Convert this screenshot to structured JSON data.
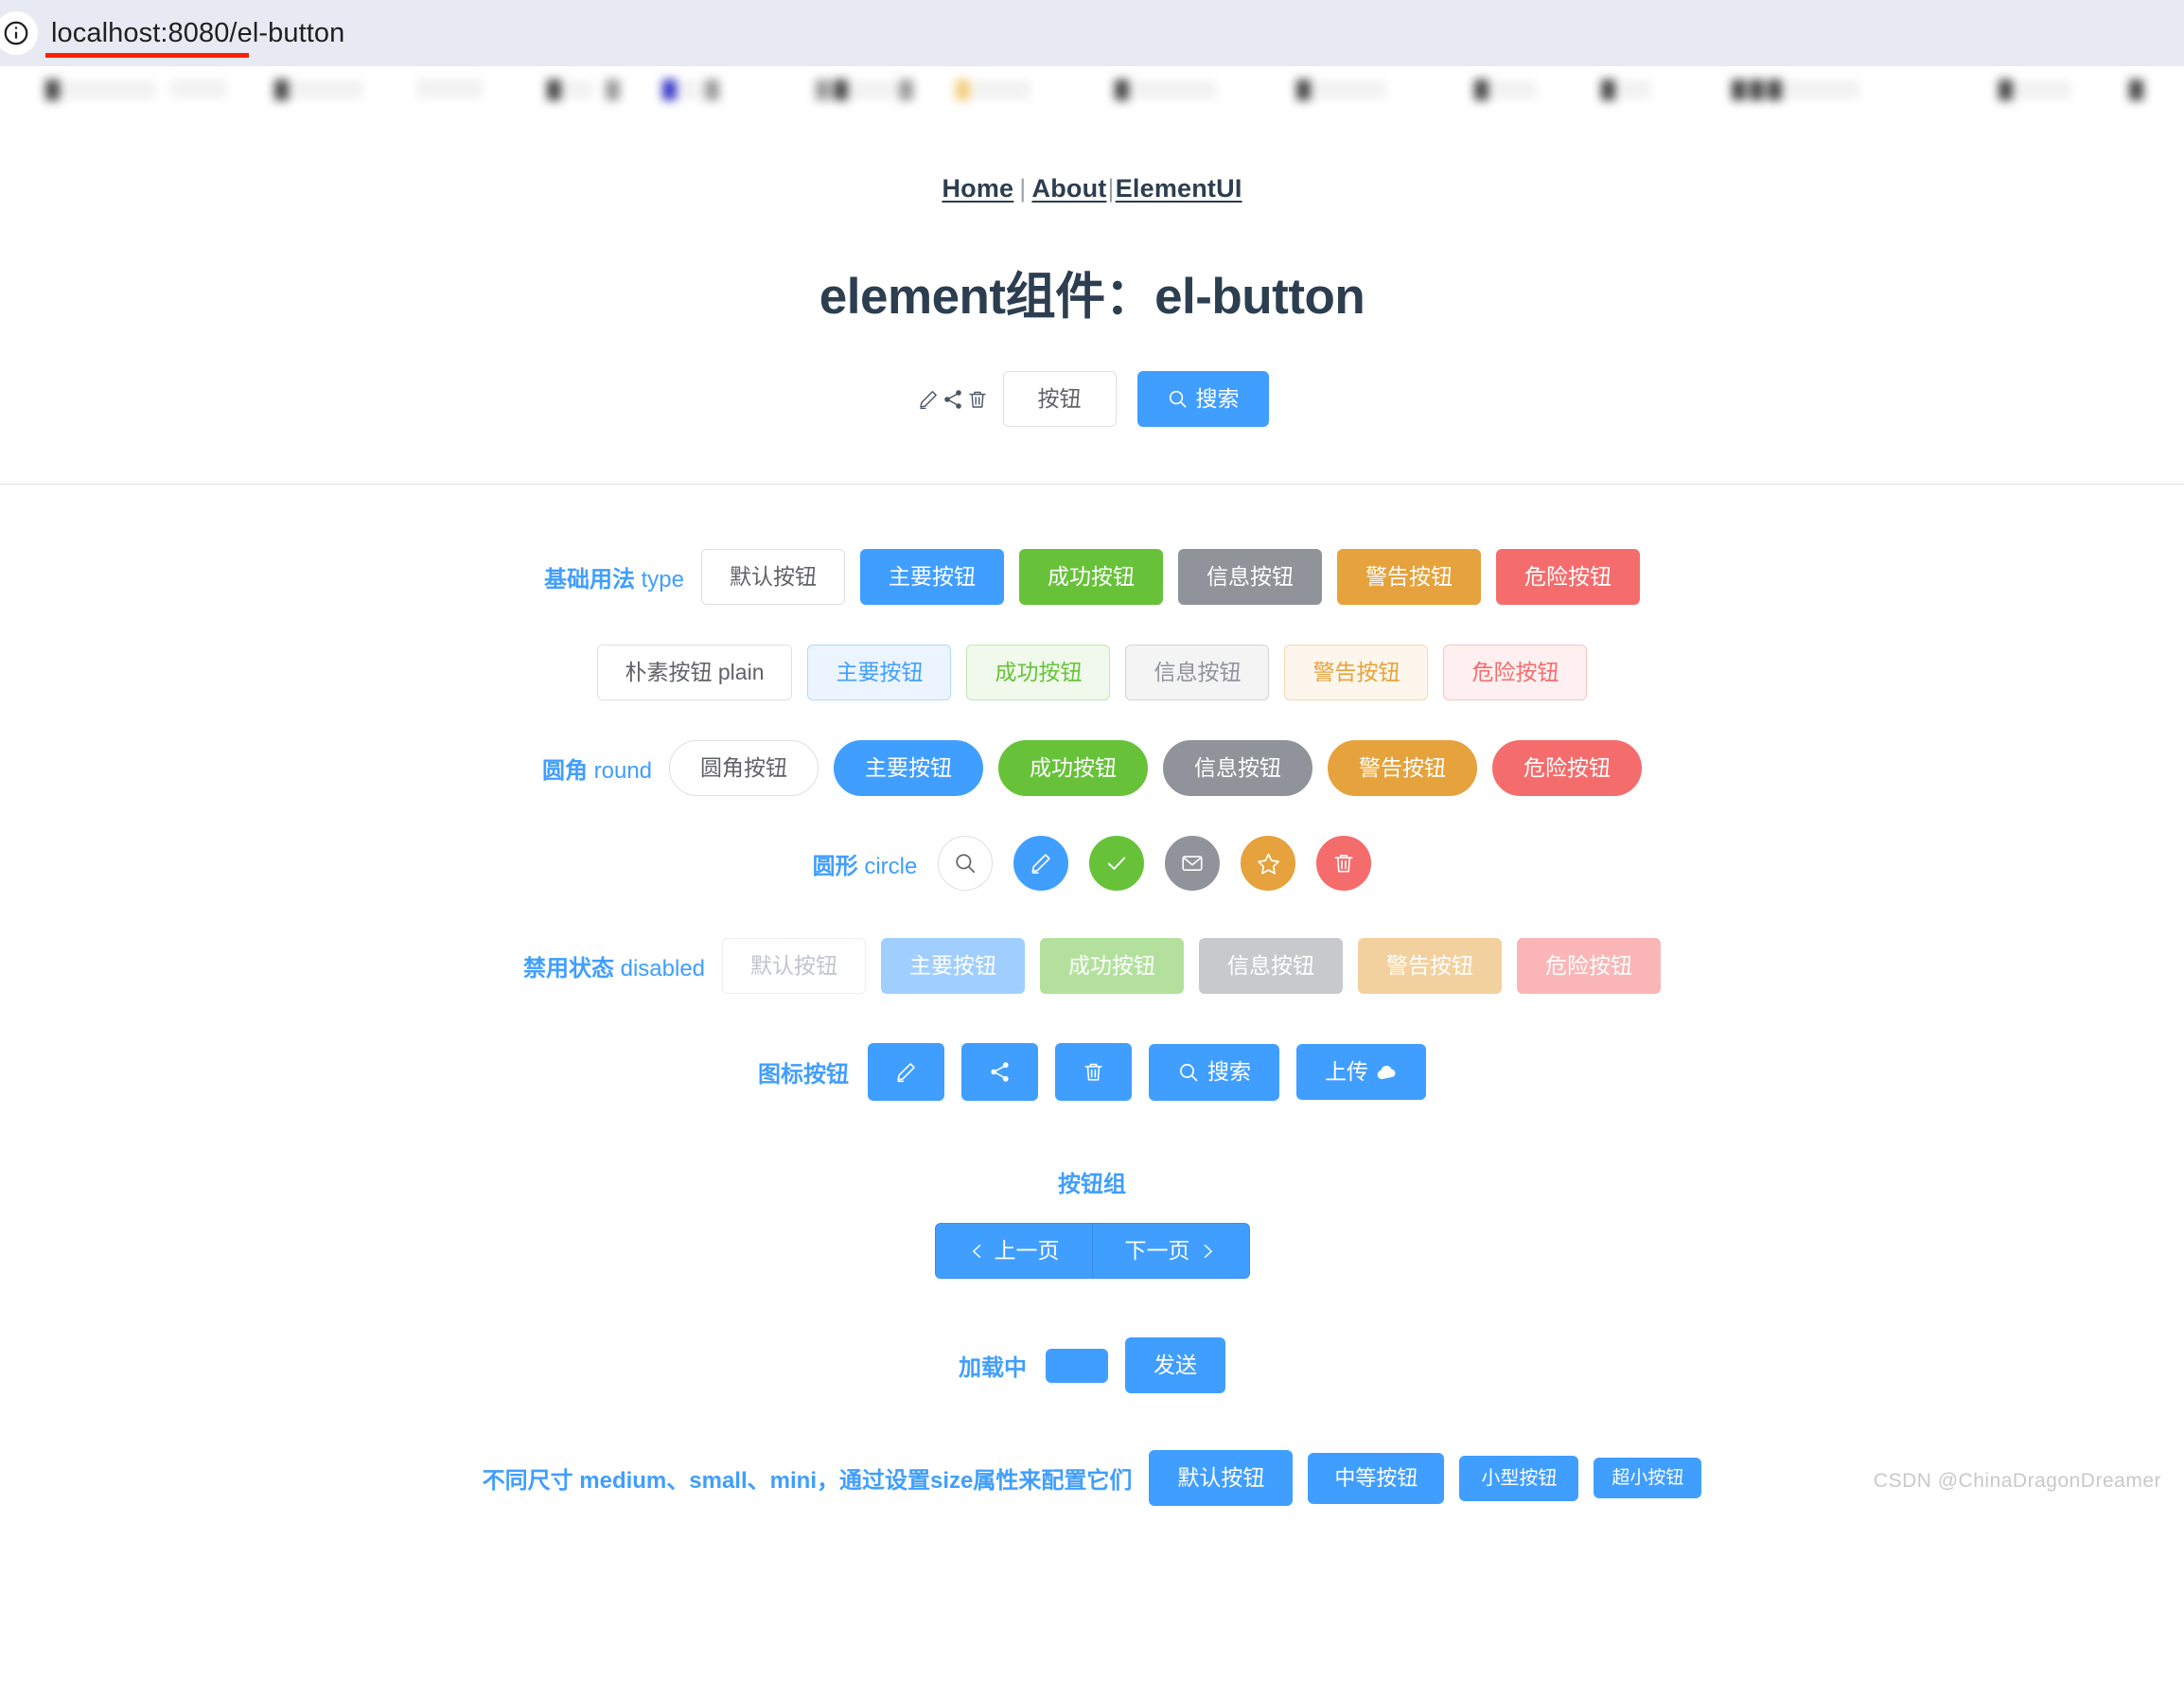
{
  "browser": {
    "url": "localhost:8080/el-button",
    "info_icon": "info-icon",
    "bookmarks_note": ""
  },
  "nav": {
    "items": [
      {
        "label": "Home"
      },
      {
        "label": "About"
      },
      {
        "label": "ElementUI"
      }
    ],
    "separator": "|"
  },
  "header": {
    "title": "element组件：el-button",
    "actions": {
      "edit_icon": "edit-icon",
      "share_icon": "share-icon",
      "delete_icon": "delete-icon",
      "plain_button": "按钮",
      "search_button": "搜索",
      "search_icon": "search-icon"
    }
  },
  "sections": {
    "basic": {
      "label_cn": "基础用法",
      "label_en": "type",
      "buttons": [
        {
          "text": "默认按钮",
          "variant": "default"
        },
        {
          "text": "主要按钮",
          "variant": "primary"
        },
        {
          "text": "成功按钮",
          "variant": "success"
        },
        {
          "text": "信息按钮",
          "variant": "info"
        },
        {
          "text": "警告按钮",
          "variant": "warning"
        },
        {
          "text": "危险按钮",
          "variant": "danger"
        }
      ]
    },
    "plain": {
      "buttons": [
        {
          "text": "朴素按钮 plain",
          "variant": "default"
        },
        {
          "text": "主要按钮",
          "variant": "primary"
        },
        {
          "text": "成功按钮",
          "variant": "success"
        },
        {
          "text": "信息按钮",
          "variant": "info"
        },
        {
          "text": "警告按钮",
          "variant": "warning"
        },
        {
          "text": "危险按钮",
          "variant": "danger"
        }
      ]
    },
    "round": {
      "label_cn": "圆角",
      "label_en": "round",
      "buttons": [
        {
          "text": "圆角按钮",
          "variant": "default"
        },
        {
          "text": "主要按钮",
          "variant": "primary"
        },
        {
          "text": "成功按钮",
          "variant": "success"
        },
        {
          "text": "信息按钮",
          "variant": "info"
        },
        {
          "text": "警告按钮",
          "variant": "warning"
        },
        {
          "text": "危险按钮",
          "variant": "danger"
        }
      ]
    },
    "circle": {
      "label_cn": "圆形",
      "label_en": "circle",
      "buttons": [
        {
          "icon": "search-icon",
          "variant": "default"
        },
        {
          "icon": "edit-icon",
          "variant": "primary"
        },
        {
          "icon": "check-icon",
          "variant": "success"
        },
        {
          "icon": "message-icon",
          "variant": "info"
        },
        {
          "icon": "star-icon",
          "variant": "warning"
        },
        {
          "icon": "delete-icon",
          "variant": "danger"
        }
      ]
    },
    "disabled": {
      "label_cn": "禁用状态",
      "label_en": "disabled",
      "buttons": [
        {
          "text": "默认按钮",
          "variant": "default"
        },
        {
          "text": "主要按钮",
          "variant": "primary"
        },
        {
          "text": "成功按钮",
          "variant": "success"
        },
        {
          "text": "信息按钮",
          "variant": "info"
        },
        {
          "text": "警告按钮",
          "variant": "warning"
        },
        {
          "text": "危险按钮",
          "variant": "danger"
        }
      ]
    },
    "icon_buttons": {
      "label": "图标按钮",
      "buttons": [
        {
          "icon": "edit-icon",
          "text": ""
        },
        {
          "icon": "share-icon",
          "text": ""
        },
        {
          "icon": "delete-icon",
          "text": ""
        },
        {
          "icon": "search-icon",
          "text": "搜索"
        },
        {
          "icon": "upload-icon",
          "text": "上传"
        }
      ]
    },
    "button_group": {
      "title": "按钮组",
      "prev": "上一页",
      "next": "下一页",
      "prev_icon": "chevron-left-icon",
      "next_icon": "chevron-right-icon"
    },
    "loading": {
      "label": "加载中",
      "loading_button_text": "",
      "send_button": "发送"
    },
    "sizes": {
      "label": "不同尺寸 medium、small、mini，通过设置size属性来配置它们",
      "buttons": [
        {
          "text": "默认按钮",
          "size": "default"
        },
        {
          "text": "中等按钮",
          "size": "medium"
        },
        {
          "text": "小型按钮",
          "size": "small"
        },
        {
          "text": "超小按钮",
          "size": "mini"
        }
      ]
    }
  },
  "watermark": "CSDN @ChinaDragonDreamer",
  "colors": {
    "primary": "#409EFF",
    "success": "#67C23A",
    "info": "#909399",
    "warning": "#E6A23C",
    "danger": "#F56C6C",
    "annotation": "#FF2200",
    "text": "#2C3E50"
  }
}
